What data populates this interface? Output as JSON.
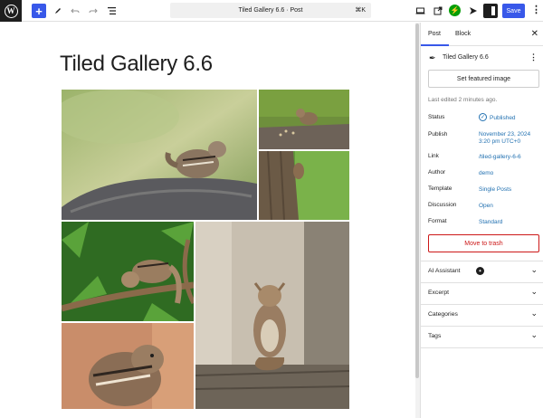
{
  "toolbar": {
    "add_icon": "+",
    "command_title": "Tiled Gallery 6.6 · Post",
    "command_shortcut": "⌘K",
    "save_label": "Save",
    "more_icon": "⋮"
  },
  "canvas": {
    "post_title": "Tiled Gallery 6.6"
  },
  "sidebar": {
    "tabs": [
      {
        "label": "Post"
      },
      {
        "label": "Block"
      }
    ],
    "close_icon": "✕",
    "doc_title": "Tiled Gallery 6.6",
    "featured_image_label": "Set featured image",
    "last_edited": "Last edited 2 minutes ago.",
    "meta": {
      "status_label": "Status",
      "status_value": "Published",
      "publish_label": "Publish",
      "publish_value_line1": "November 23, 2024",
      "publish_value_line2": "3:20 pm UTC+0",
      "link_label": "Link",
      "link_value": "/tiled-gallery-6-6",
      "author_label": "Author",
      "author_value": "demo",
      "template_label": "Template",
      "template_value": "Single Posts",
      "discussion_label": "Discussion",
      "discussion_value": "Open",
      "format_label": "Format",
      "format_value": "Standard"
    },
    "trash_label": "Move to trash",
    "panels": [
      {
        "label": "AI Assistant"
      },
      {
        "label": "Excerpt"
      },
      {
        "label": "Categories"
      },
      {
        "label": "Tags"
      }
    ]
  },
  "colors": {
    "accent": "#3858e9",
    "link": "#2271b1",
    "danger": "#cc1818",
    "jetpack": "#069e08"
  }
}
